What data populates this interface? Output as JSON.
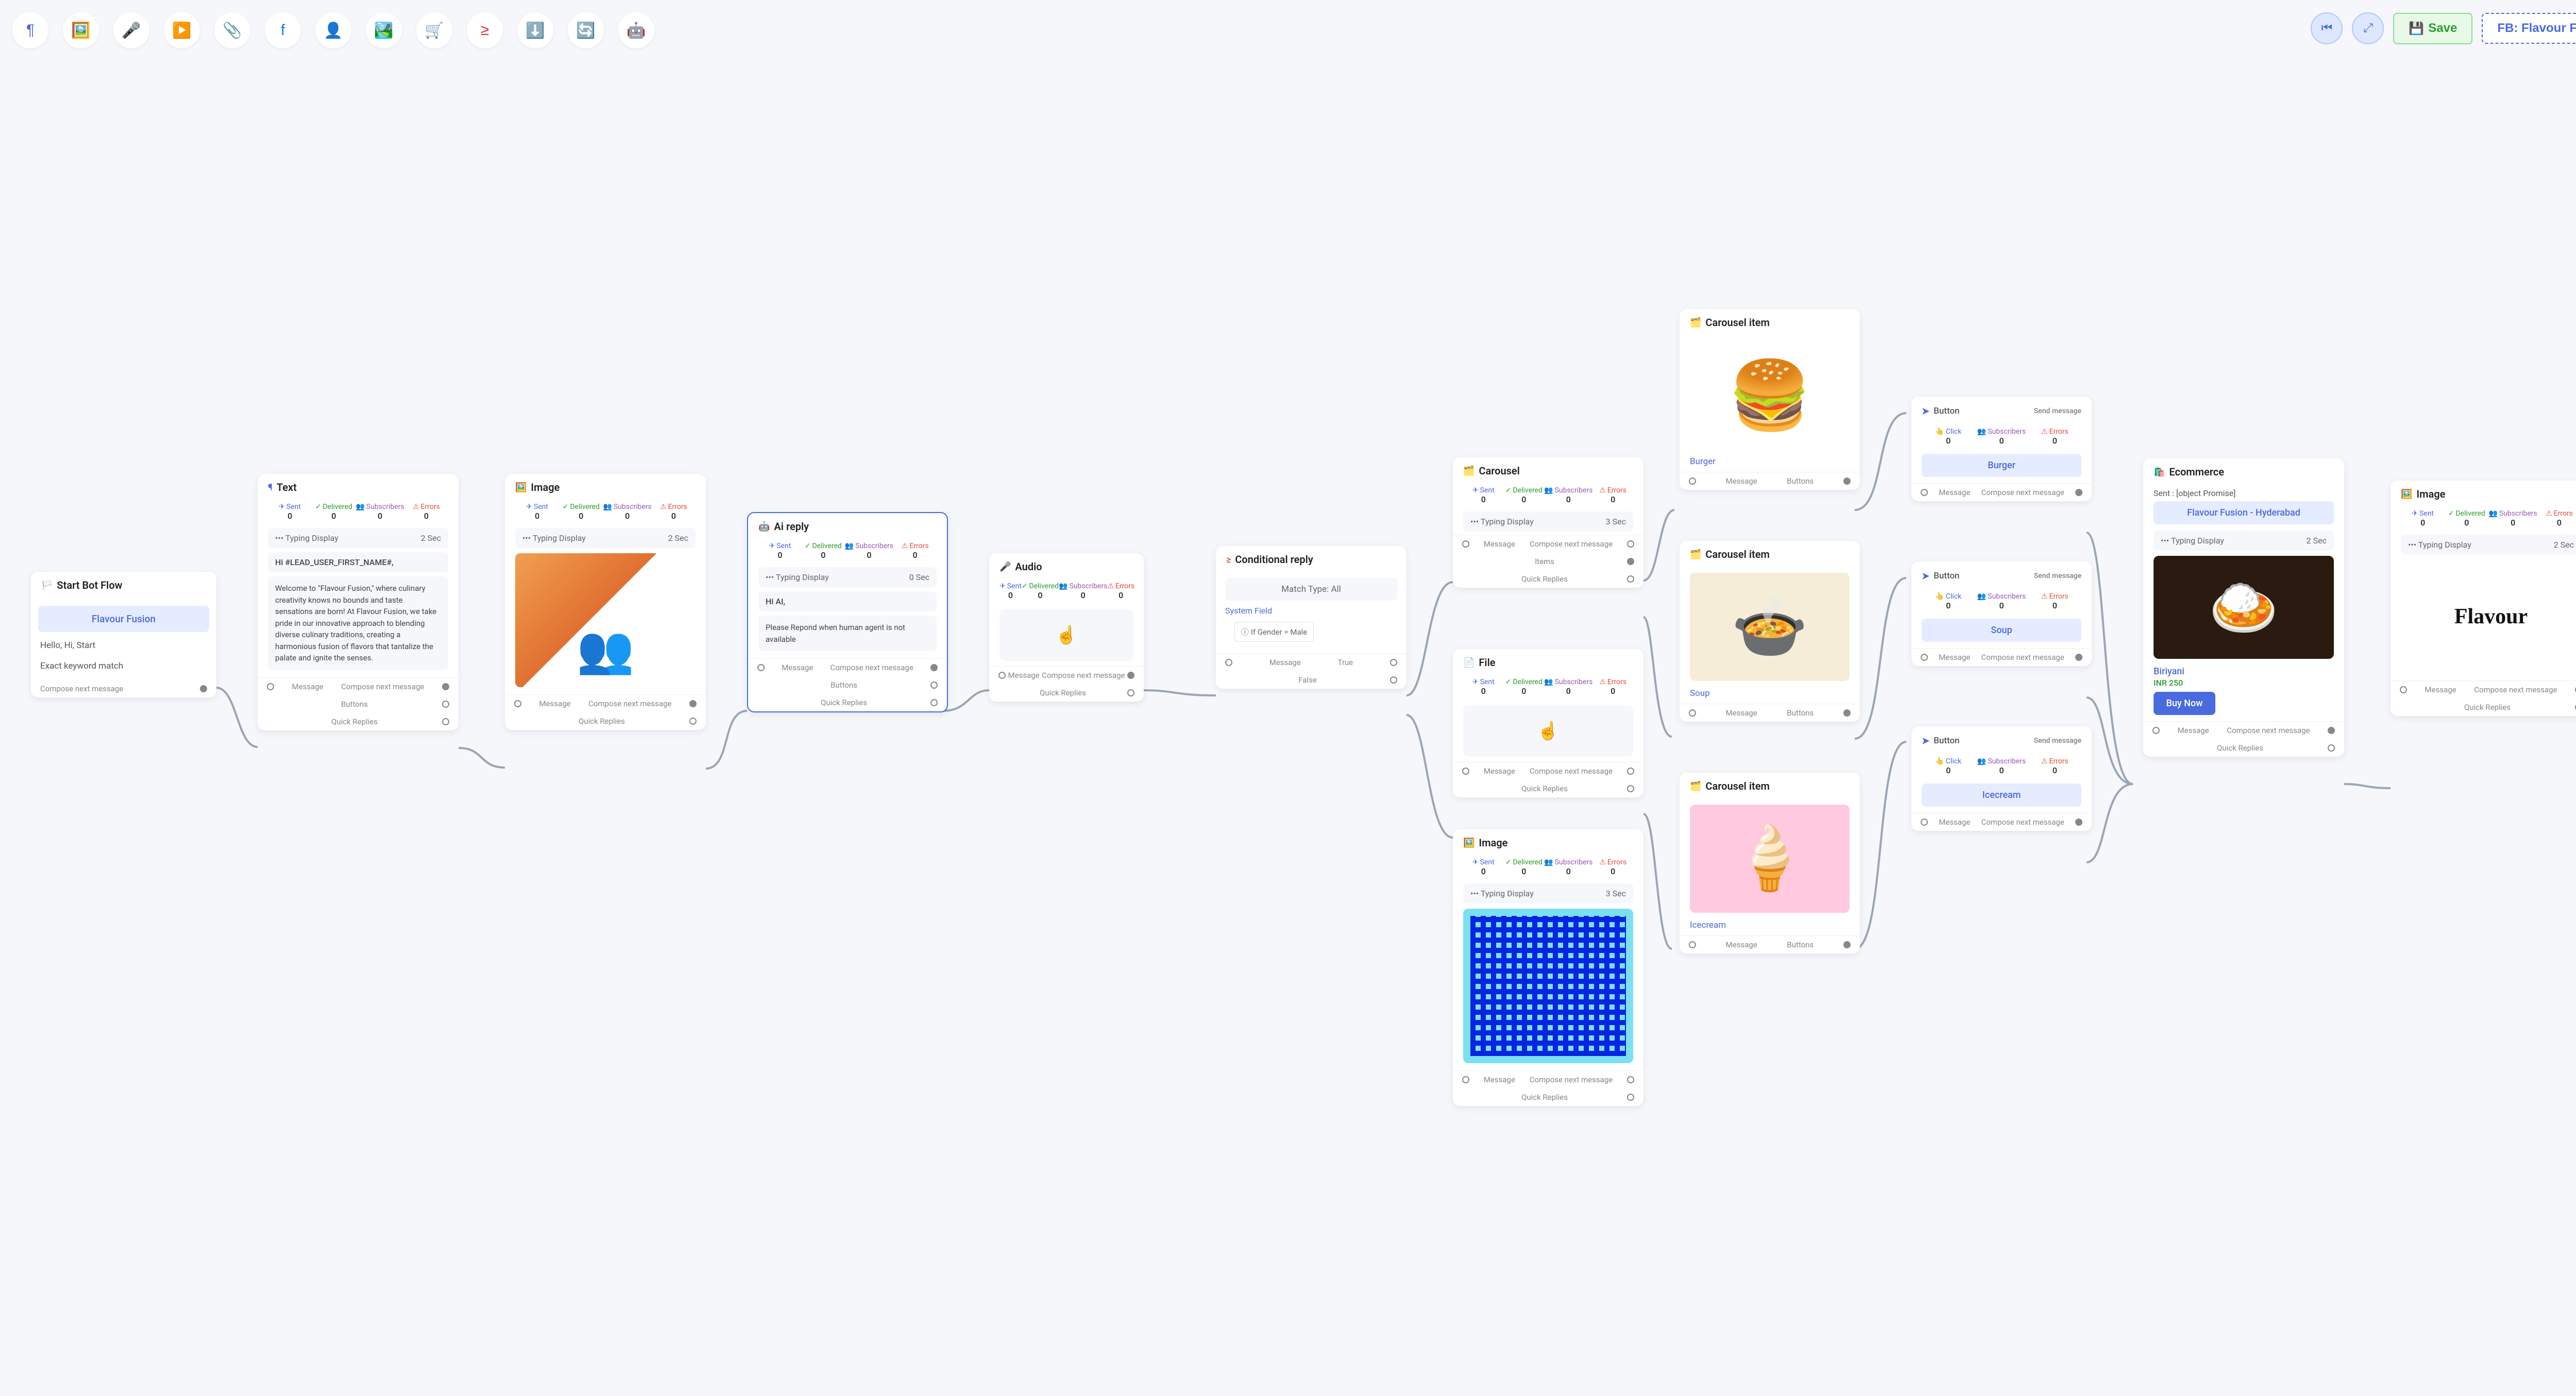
{
  "header": {
    "save_label": "Save",
    "flow_label": "FB: Flavour Fusion"
  },
  "toolbar": {
    "icons": [
      "¶",
      "🖼️",
      "🎤",
      "▶️",
      "📎",
      "f",
      "👤",
      "🏞️",
      "🛒",
      "≥",
      "📥",
      "🔄",
      "🤖"
    ]
  },
  "labels": {
    "sent": "Sent",
    "delivered": "Delivered",
    "subscribers": "Subscribers",
    "errors": "Errors",
    "click": "Click",
    "typing": "Typing Display",
    "message": "Message",
    "compose": "Compose next message",
    "buttons": "Buttons",
    "quickreplies": "Quick Replies",
    "items": "Items",
    "true": "True",
    "false": "False",
    "sendmsg": "Send message"
  },
  "nodes": {
    "start": {
      "title": "Start Bot Flow",
      "pill": "Flavour Fusion",
      "line1": "Hello, Hi, Start",
      "line2": "Exact keyword match",
      "footer": "Compose next message"
    },
    "text": {
      "title": "Text",
      "typing_time": "2 Sec",
      "greet": "Hi  #LEAD_USER_FIRST_NAME#,",
      "body": "Welcome to \"Flavour Fusion,\" where culinary creativity knows no bounds and taste sensations are born! At Flavour Fusion, we take pride in our innovative approach to blending diverse culinary traditions, creating a harmonious fusion of flavors that tantalize the palate and ignite the senses."
    },
    "image1": {
      "title": "Image",
      "typing_time": "2 Sec"
    },
    "ai": {
      "title": "Ai reply",
      "typing_time": "0 Sec",
      "greet": "Hi AI,",
      "body": "Please Repond when human agent is not available"
    },
    "audio": {
      "title": "Audio"
    },
    "cond": {
      "title": "Conditional reply",
      "match": "Match Type: All",
      "sysfield": "System Field",
      "rule": "If Gender = Male"
    },
    "carousel": {
      "title": "Carousel",
      "typing_time": "3 Sec"
    },
    "file": {
      "title": "File",
      "typing_time": "3 Sec"
    },
    "citem1": {
      "title": "Carousel item",
      "caption": "Burger"
    },
    "citem2": {
      "title": "Carousel item",
      "caption": "Soup"
    },
    "citem3": {
      "title": "Carousel item",
      "caption": "Icecream"
    },
    "btn1": {
      "title": "Button",
      "action": "Burger"
    },
    "btn2": {
      "title": "Button",
      "action": "Soup"
    },
    "btn3": {
      "title": "Button",
      "action": "Icecream"
    },
    "ecom": {
      "title": "Ecommerce",
      "sent_line": "Sent : [object Promise]",
      "store": "Flavour Fusion - Hyderabad",
      "typing_time": "2 Sec",
      "product": "Biriyani",
      "price": "INR 250",
      "buy": "Buy Now"
    },
    "image2": {
      "title": "Image",
      "typing_time": "2 Sec",
      "logo_text": "Flavour"
    }
  },
  "zeros": {
    "z": "0"
  }
}
